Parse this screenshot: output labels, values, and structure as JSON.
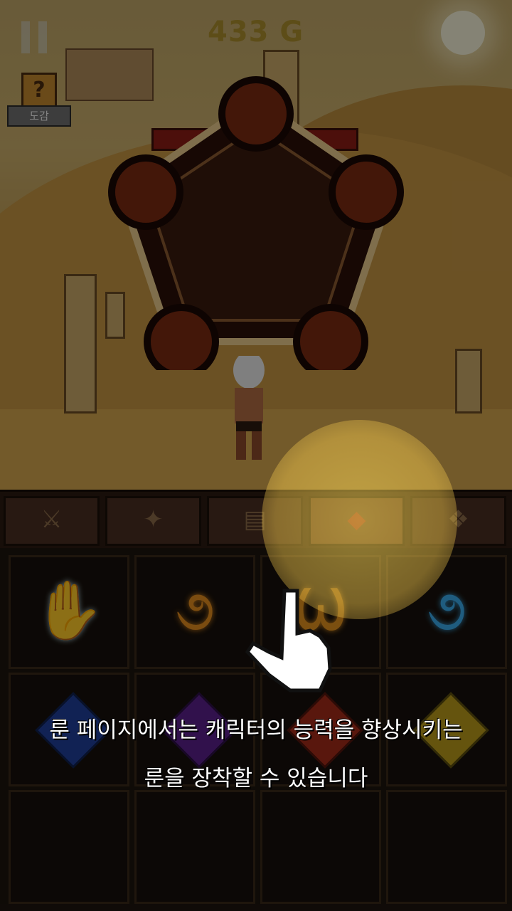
{
  "hud": {
    "gold": "433 G",
    "dogam_label": "도감",
    "dogam_icon": "?"
  },
  "tabs": [
    {
      "name": "weapon",
      "icon": "⚔"
    },
    {
      "name": "skill",
      "icon": "✦"
    },
    {
      "name": "map",
      "icon": "▤"
    },
    {
      "name": "rune",
      "icon": "◆",
      "active": true
    },
    {
      "name": "pet",
      "icon": "❖"
    }
  ],
  "runes_row1": [
    {
      "glyph": "✋",
      "color": "#a9c6cf"
    },
    {
      "glyph": "૭",
      "color": "#e08a1e"
    },
    {
      "glyph": "Ѡ",
      "color": "#e0901e"
    },
    {
      "glyph": "૭",
      "color": "#3aa8e8"
    }
  ],
  "gems_row2": [
    {
      "color": "#1f3f9a"
    },
    {
      "color": "#5a1f8a"
    },
    {
      "color": "#a32a18"
    },
    {
      "color": "#b89a1a"
    }
  ],
  "tutorial": {
    "line1": "룬 페이지에서는 캐릭터의 능력을 향상시키는",
    "line2": "룬을 장착할 수 있습니다"
  }
}
